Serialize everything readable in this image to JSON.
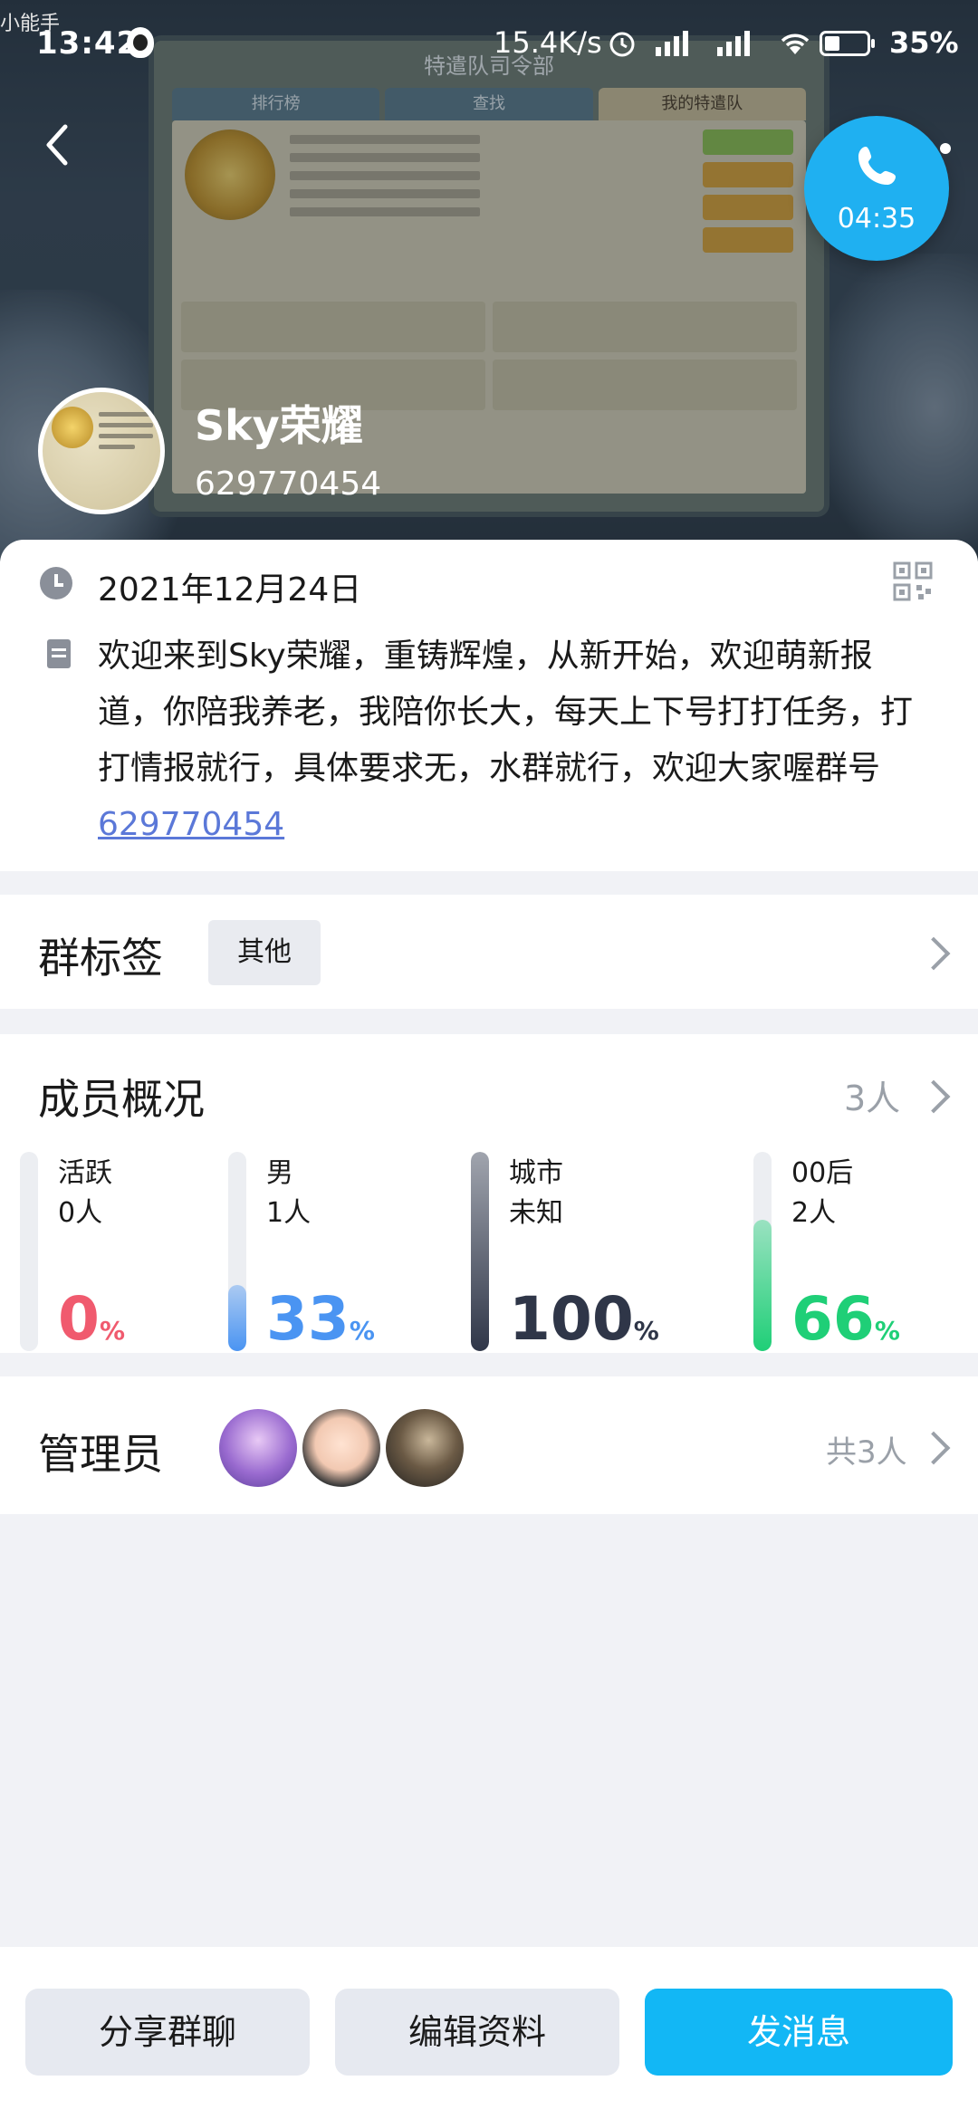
{
  "status_bar": {
    "time": "13:42",
    "network_speed": "15.4K/s",
    "battery_percent": "35%",
    "background_caption": "小能手"
  },
  "header": {
    "background_game_title": "特遣队司令部",
    "background_tabs": [
      "排行榜",
      "查找",
      "我的特遣队"
    ],
    "group_name": "Sky荣耀",
    "group_id": "629770454"
  },
  "call": {
    "duration": "04:35"
  },
  "info": {
    "created_date": "2021年12月24日",
    "description": "欢迎来到Sky荣耀，重铸辉煌，从新开始，欢迎萌新报道，你陪我养老，我陪你长大，每天上下号打打任务，打打情报就行，具体要求无，水群就行，欢迎大家喔群号",
    "description_link": "629770454"
  },
  "tags": {
    "title": "群标签",
    "chip": "其他"
  },
  "members": {
    "title": "成员概况",
    "count": "3人",
    "stats": [
      {
        "label": "活跃",
        "sub": "0人",
        "percent": "0",
        "fraction": 0.0,
        "color": "#f05a6e"
      },
      {
        "label": "男",
        "sub": "1人",
        "percent": "33",
        "fraction": 0.33,
        "color": "#4a94f2"
      },
      {
        "label": "城市",
        "sub": "未知",
        "percent": "100",
        "fraction": 1.0,
        "color": "#2f3648"
      },
      {
        "label": "00后",
        "sub": "2人",
        "percent": "66",
        "fraction": 0.66,
        "color": "#1fcf77"
      }
    ],
    "percent_unit": "%"
  },
  "admins": {
    "title": "管理员",
    "count": "共3人"
  },
  "bottom": {
    "share": "分享群聊",
    "edit": "编辑资料",
    "message": "发消息"
  }
}
